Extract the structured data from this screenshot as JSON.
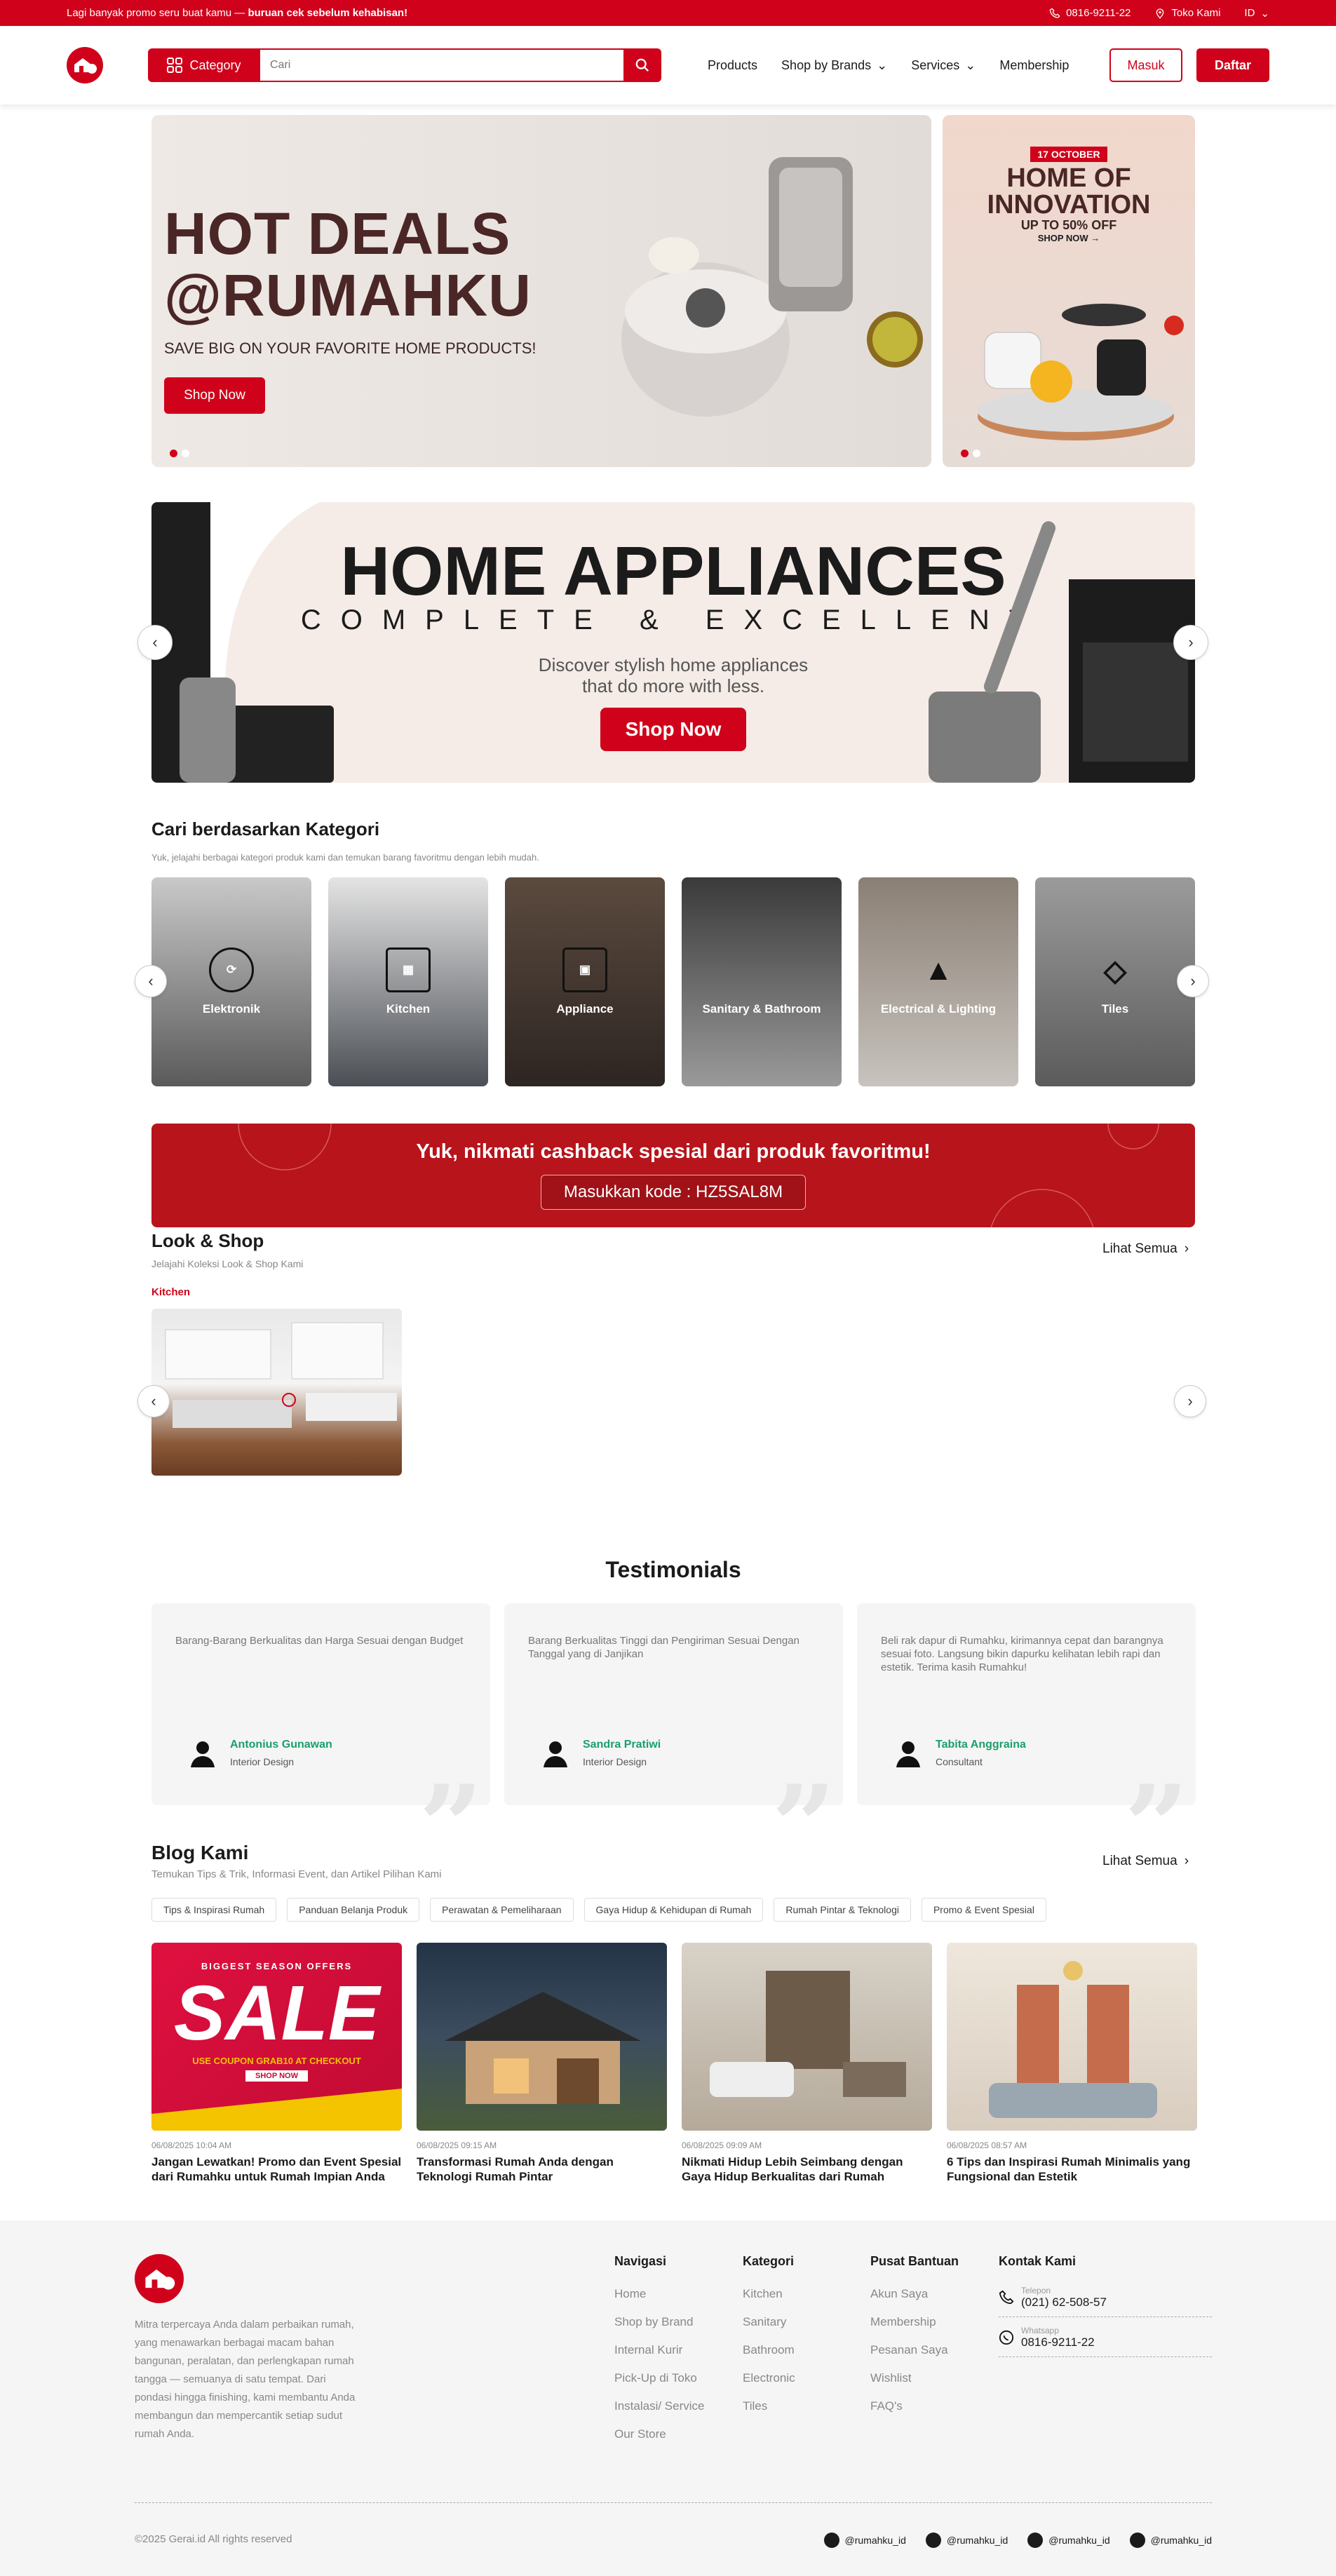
{
  "topbar": {
    "promo_prefix": "Lagi banyak promo seru buat kamu — ",
    "promo_bold": "buruan cek sebelum kehabisan!",
    "phone": "0816-9211-22",
    "store": "Toko Kami",
    "lang": "ID"
  },
  "header": {
    "category": "Category",
    "search_placeholder": "Cari",
    "nav": [
      "Products",
      "Shop by Brands",
      "Services",
      "Membership"
    ],
    "login": "Masuk",
    "register": "Daftar"
  },
  "hero": {
    "title_line1": "HOT DEALS",
    "title_line2": "@RUMAHKU",
    "subtitle": "SAVE BIG ON YOUR FAVORITE HOME PRODUCTS!",
    "cta": "Shop Now"
  },
  "side_banner": {
    "date": "17 OCTOBER",
    "title": "HOME OF INNOVATION",
    "offer": "UP TO 50% OFF",
    "cta": "SHOP NOW →"
  },
  "appliance_banner": {
    "title": "HOME APPLIANCES",
    "subtitle": "COMPLETE & EXCELLENT",
    "desc_line1": "Discover stylish home appliances",
    "desc_line2": "that do more with less.",
    "cta": "Shop Now"
  },
  "categories": {
    "title": "Cari berdasarkan Kategori",
    "subtitle": "Yuk, jelajahi berbagai kategori produk kami dan temukan barang favoritmu dengan lebih mudah.",
    "items": [
      "Elektronik",
      "Kitchen",
      "Appliance",
      "Sanitary & Bathroom",
      "Electrical & Lighting",
      "Tiles"
    ]
  },
  "cashback": {
    "title": "Yuk, nikmati cashback spesial dari produk favoritmu!",
    "code": "Masukkan kode : HZ5SAL8M"
  },
  "look_shop": {
    "title": "Look & Shop",
    "subtitle": "Jelajahi Koleksi Look & Shop Kami",
    "see_all": "Lihat Semua",
    "tab": "Kitchen"
  },
  "testimonials": {
    "title": "Testimonials",
    "items": [
      {
        "text": "Barang-Barang Berkualitas dan Harga Sesuai dengan Budget",
        "name": "Antonius Gunawan",
        "role": "Interior Design"
      },
      {
        "text": "Barang Berkualitas Tinggi dan Pengiriman Sesuai Dengan Tanggal yang di Janjikan",
        "name": "Sandra Pratiwi",
        "role": "Interior Design"
      },
      {
        "text": "Beli rak dapur di Rumahku, kirimannya cepat dan barangnya sesuai foto. Langsung bikin dapurku kelihatan lebih rapi dan estetik. Terima kasih Rumahku!",
        "name": "Tabita Anggraina",
        "role": "Consultant"
      }
    ]
  },
  "blog": {
    "title": "Blog Kami",
    "subtitle": "Temukan Tips & Trik, Informasi Event, dan Artikel Pilihan Kami",
    "see_all": "Lihat Semua",
    "chips": [
      "Tips & Inspirasi Rumah",
      "Panduan Belanja Produk",
      "Perawatan & Pemeliharaan",
      "Gaya Hidup & Kehidupan di Rumah",
      "Rumah Pintar & Teknologi",
      "Promo & Event Spesial"
    ],
    "sale_top": "BIGGEST SEASON OFFERS",
    "sale_word": "SALE",
    "sale_coupon": "USE COUPON GRAB10 AT CHECKOUT",
    "sale_btn": "SHOP NOW",
    "posts": [
      {
        "date": "06/08/2025 10:04 AM",
        "title": "Jangan Lewatkan! Promo dan Event Spesial dari Rumahku untuk Rumah Impian Anda"
      },
      {
        "date": "06/08/2025 09:15 AM",
        "title": "Transformasi Rumah Anda dengan Teknologi Rumah Pintar"
      },
      {
        "date": "06/08/2025 09:09 AM",
        "title": "Nikmati Hidup Lebih Seimbang dengan Gaya Hidup Berkualitas dari Rumah"
      },
      {
        "date": "06/08/2025 08:57 AM",
        "title": "6 Tips dan Inspirasi Rumah Minimalis yang Fungsional dan Estetik"
      }
    ]
  },
  "footer": {
    "desc": "Mitra terpercaya Anda dalam perbaikan rumah, yang menawarkan berbagai macam bahan bangunan, peralatan, dan perlengkapan rumah tangga — semuanya di satu tempat. Dari pondasi hingga finishing, kami membantu Anda membangun dan mempercantik setiap sudut rumah Anda.",
    "nav_title": "Navigasi",
    "nav": [
      "Home",
      "Shop by Brand",
      "Internal Kurir",
      "Pick-Up di Toko",
      "Instalasi/ Service",
      "Our Store"
    ],
    "cat_title": "Kategori",
    "cats": [
      "Kitchen",
      "Sanitary",
      "Bathroom",
      "Electronic",
      "Tiles"
    ],
    "help_title": "Pusat Bantuan",
    "help": [
      "Akun Saya",
      "Membership",
      "Pesanan Saya",
      "Wishlist",
      "FAQ's"
    ],
    "contact_title": "Kontak Kami",
    "phone_label": "Telepon",
    "phone": "(021) 62-508-57",
    "wa_label": "Whatsapp",
    "wa": "0816-9211-22",
    "copyright": "©2025 Gerai.id All rights reserved",
    "socials": [
      "@rumahku_id",
      "@rumahku_id",
      "@rumahku_id",
      "@rumahku_id"
    ]
  }
}
